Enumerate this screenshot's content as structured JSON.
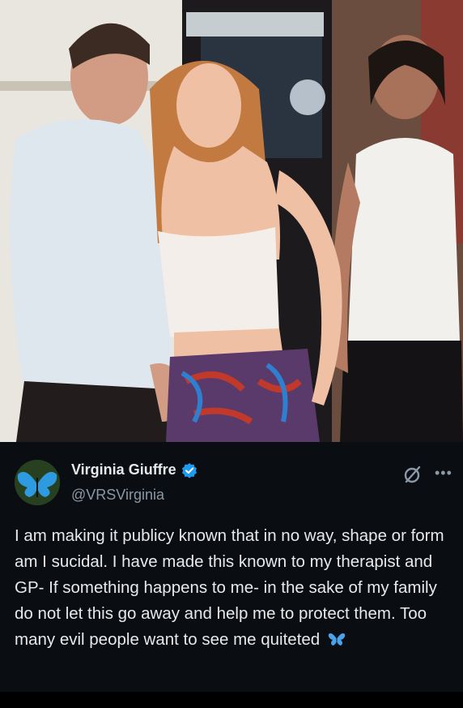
{
  "post": {
    "display_name": "Virginia Giuffre",
    "handle": "@VRSVirginia",
    "body": "I am making it publicy known that in no way, shape or form am I sucidal. I have made this known to my therapist and GP- If something happens to me- in the sake of my family do not let this go away and help me to protect them. Too many evil people want to see me quiteted"
  },
  "icons": {
    "avatar": "butterfly-avatar",
    "verified": "verified-badge-icon",
    "grok": "grok-icon",
    "more": "more-icon",
    "inline_emoji": "butterfly-icon"
  },
  "colors": {
    "background": "#0a0d12",
    "text": "#e7e9ea",
    "secondary_text": "#8b98a5",
    "verified_blue": "#1d9bf0"
  }
}
